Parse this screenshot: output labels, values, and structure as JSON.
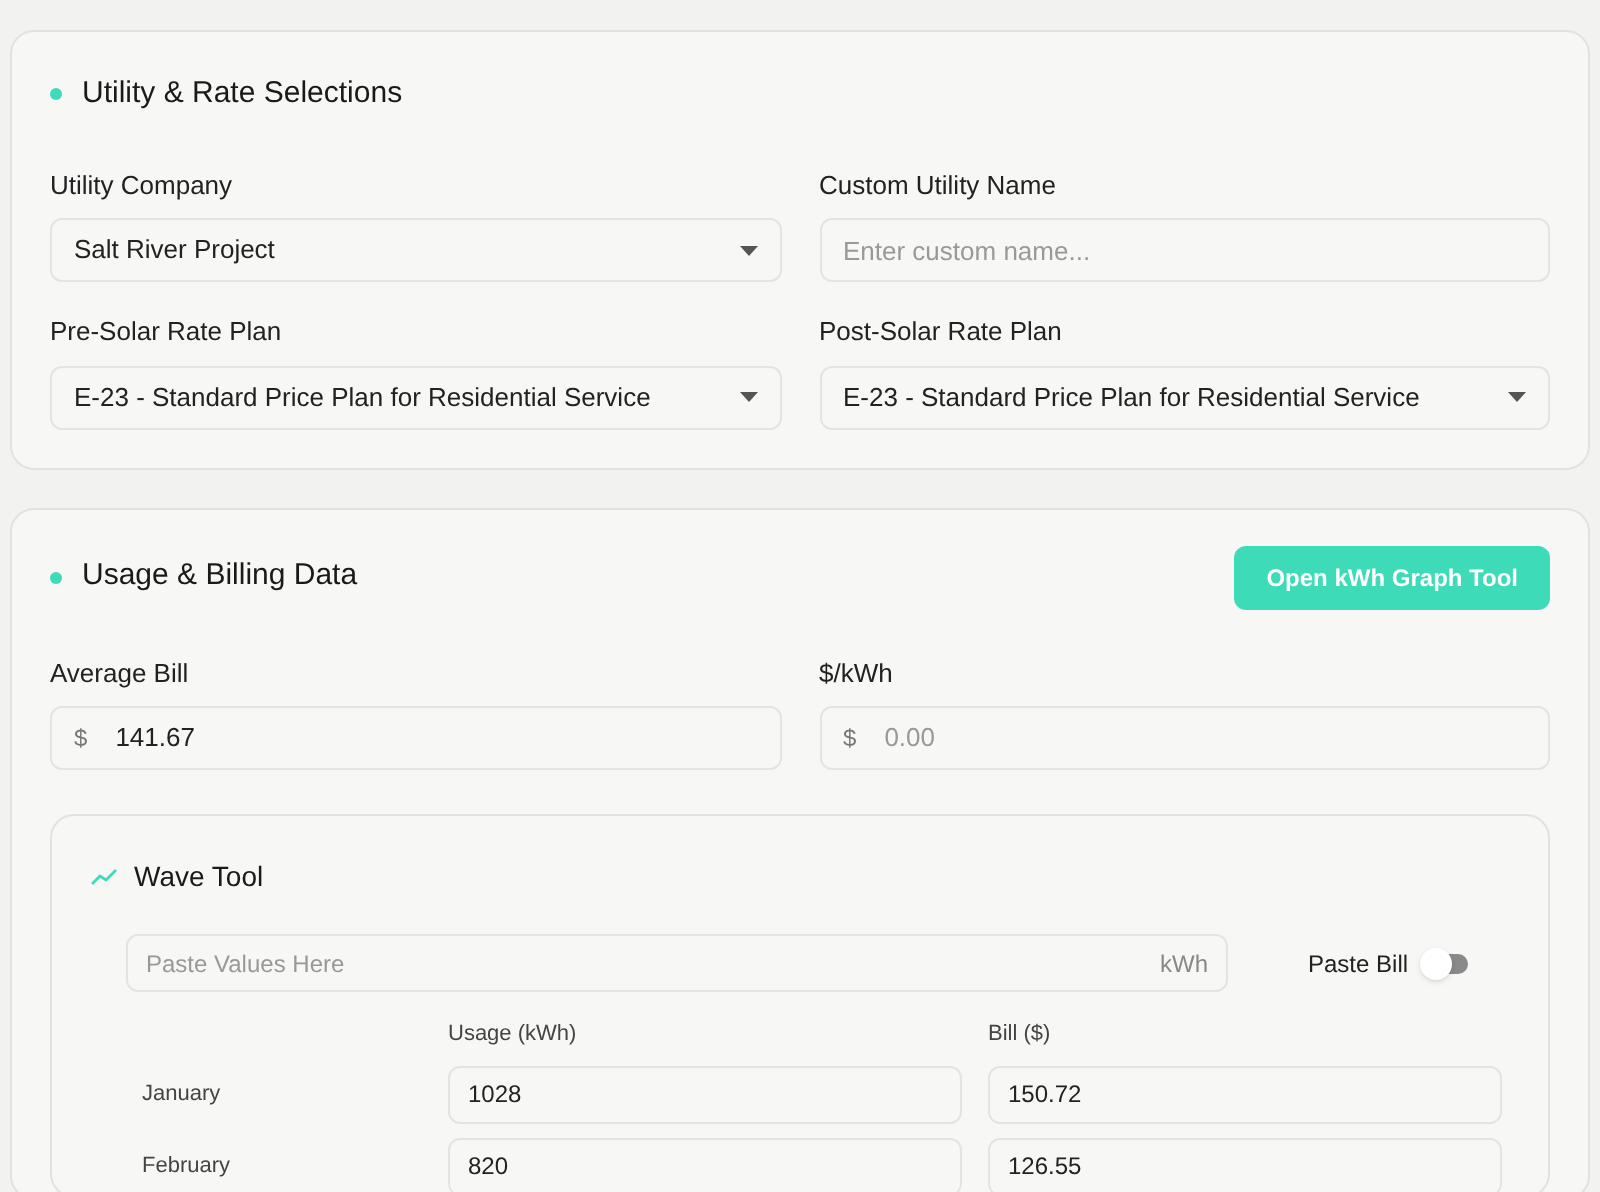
{
  "utility_section": {
    "title": "Utility & Rate Selections",
    "fields": [
      {
        "kind": "select",
        "label": "Utility Company",
        "value": "Salt River Project"
      },
      {
        "kind": "text",
        "label": "Custom Utility Name",
        "placeholder": "Enter custom name..."
      },
      {
        "kind": "select",
        "label": "Pre-Solar Rate Plan",
        "value": "E-23 - Standard Price Plan for Residential Service"
      },
      {
        "kind": "select",
        "label": "Post-Solar Rate Plan",
        "value": "E-23 - Standard Price Plan for Residential Service"
      }
    ]
  },
  "usage_section": {
    "title": "Usage & Billing Data",
    "button": "Open kWh Graph Tool",
    "fields": [
      {
        "label": "Average Bill",
        "prefix": "$",
        "value": "141.67"
      },
      {
        "label": "$/kWh",
        "prefix": "$",
        "placeholder": "0.00"
      }
    ]
  },
  "wave_tool": {
    "title": "Wave Tool",
    "paste_field": {
      "placeholder": "Paste Values Here",
      "suffix": "kWh"
    },
    "toggle": {
      "label": "Paste Bill",
      "on": false
    },
    "columns": [
      "Usage (kWh)",
      "Bill ($)"
    ],
    "rows": [
      {
        "month": "January",
        "usage": "1028",
        "bill": "150.72"
      },
      {
        "month": "February",
        "usage": "820",
        "bill": "126.55"
      }
    ]
  }
}
